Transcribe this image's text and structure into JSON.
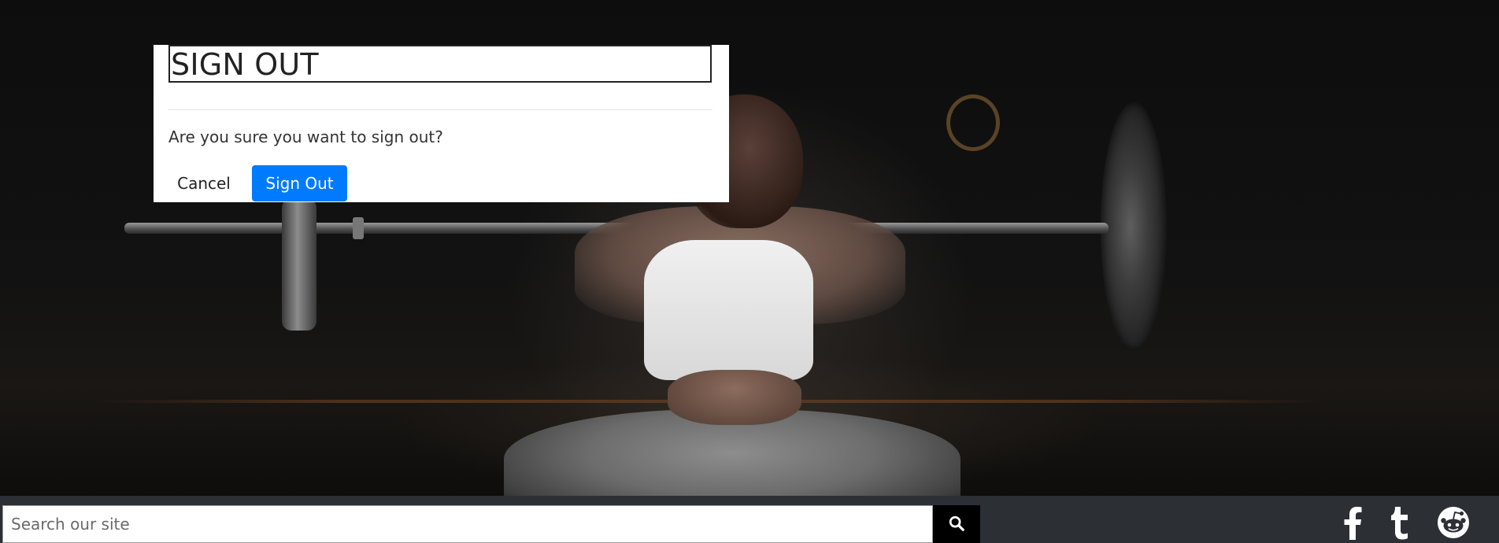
{
  "modal": {
    "title": "SIGN OUT",
    "message": "Are you sure you want to sign out?",
    "cancel_label": "Cancel",
    "confirm_label": "Sign Out"
  },
  "footer": {
    "search": {
      "placeholder": "Search our site",
      "value": "",
      "button_icon": "search-icon"
    },
    "social": [
      {
        "icon": "facebook-icon"
      },
      {
        "icon": "tumblr-icon"
      },
      {
        "icon": "reddit-icon"
      }
    ]
  },
  "colors": {
    "primary": "#007bff",
    "footer_bg": "#2c3035",
    "modal_bg": "#ffffff",
    "search_button_bg": "#000000"
  }
}
